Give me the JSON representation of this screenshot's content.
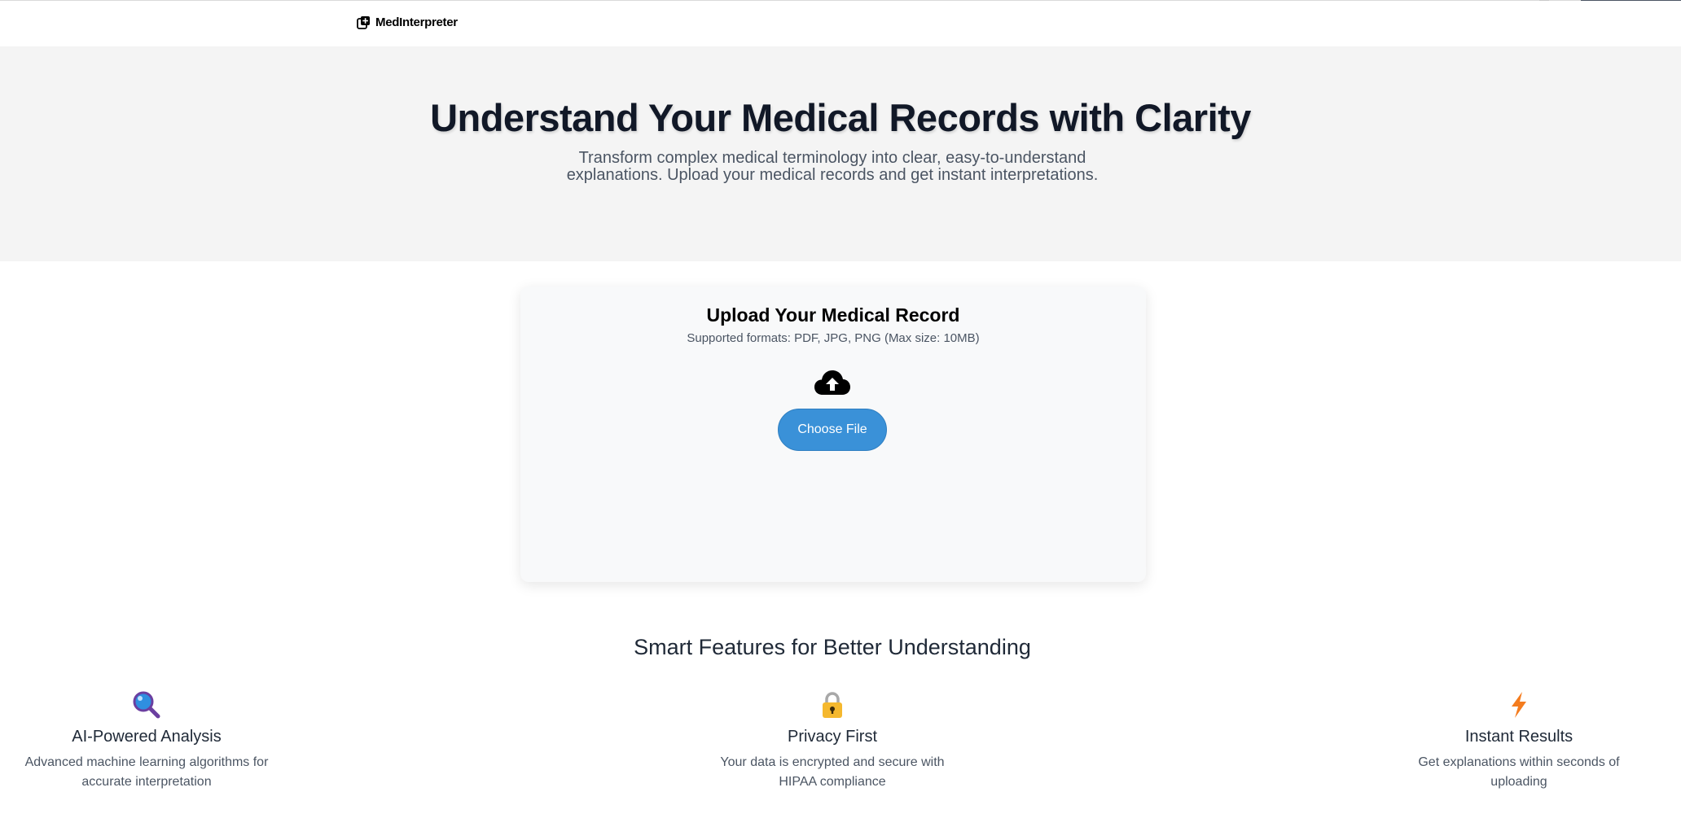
{
  "brand": {
    "name": "MedInterpreter",
    "icon": "medical-plus-icon"
  },
  "hero": {
    "title": "Understand Your Medical Records with Clarity",
    "subtitle": "Transform complex medical terminology into clear, easy-to-understand explanations. Upload your medical records and get instant interpretations."
  },
  "upload": {
    "title": "Upload Your Medical Record",
    "formats": "Supported formats: PDF, JPG, PNG (Max size: 10MB)",
    "icon": "cloud-upload-icon",
    "button_label": "Choose File"
  },
  "features": {
    "title": "Smart Features for Better Understanding",
    "items": [
      {
        "icon": "magnifier-icon",
        "title": "AI-Powered Analysis",
        "desc": "Advanced machine learning algorithms for accurate interpretation"
      },
      {
        "icon": "lock-icon",
        "title": "Privacy First",
        "desc": "Your data is encrypted and secure with HIPAA compliance"
      },
      {
        "icon": "lightning-icon",
        "title": "Instant Results",
        "desc": "Get explanations within seconds of uploading"
      }
    ]
  },
  "colors": {
    "accent": "#3a91d8",
    "hero_bg": "#f4f4f4",
    "card_bg": "#f8f9fa",
    "text_dark": "#111827",
    "text_muted": "#4b5563"
  }
}
